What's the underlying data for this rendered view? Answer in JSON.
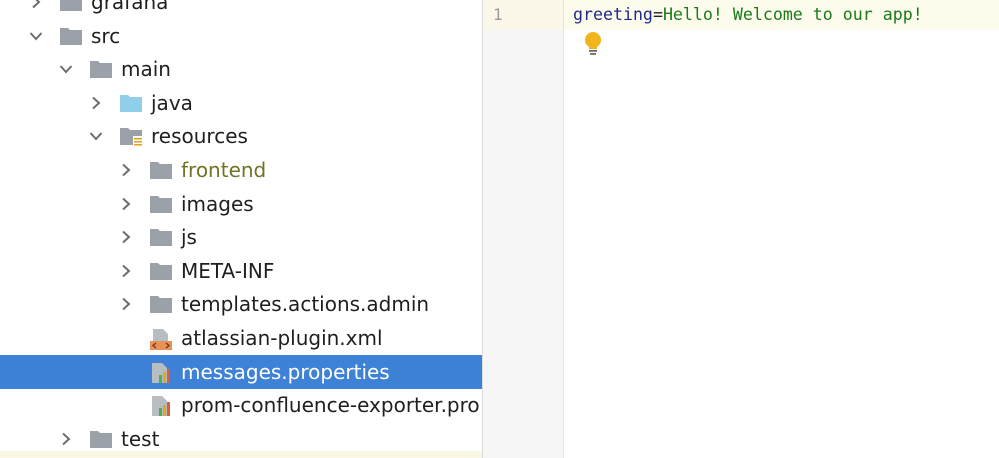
{
  "project_tree": {
    "items": [
      {
        "label": "grafana",
        "depth": 1,
        "expanded": false,
        "icon": "folder-icon",
        "has_chevron": true
      },
      {
        "label": "src",
        "depth": 1,
        "expanded": true,
        "icon": "folder-icon",
        "has_chevron": true
      },
      {
        "label": "main",
        "depth": 2,
        "expanded": true,
        "icon": "folder-icon",
        "has_chevron": true
      },
      {
        "label": "java",
        "depth": 3,
        "expanded": false,
        "icon": "source-folder-icon",
        "has_chevron": true
      },
      {
        "label": "resources",
        "depth": 3,
        "expanded": true,
        "icon": "resources-folder-icon",
        "has_chevron": true
      },
      {
        "label": "frontend",
        "depth": 4,
        "expanded": false,
        "icon": "folder-icon",
        "has_chevron": true,
        "highlight": "olive"
      },
      {
        "label": "images",
        "depth": 4,
        "expanded": false,
        "icon": "folder-icon",
        "has_chevron": true
      },
      {
        "label": "js",
        "depth": 4,
        "expanded": false,
        "icon": "folder-icon",
        "has_chevron": true
      },
      {
        "label": "META-INF",
        "depth": 4,
        "expanded": false,
        "icon": "folder-icon",
        "has_chevron": true
      },
      {
        "label": "templates.actions.admin",
        "depth": 4,
        "expanded": false,
        "icon": "folder-icon",
        "has_chevron": true
      },
      {
        "label": "atlassian-plugin.xml",
        "depth": 4,
        "icon": "xml-file-icon",
        "has_chevron": false
      },
      {
        "label": "messages.properties",
        "depth": 4,
        "icon": "properties-file-icon",
        "has_chevron": false,
        "selected": true
      },
      {
        "label": "prom-confluence-exporter.pro",
        "depth": 4,
        "icon": "properties-file-icon",
        "has_chevron": false
      },
      {
        "label": "test",
        "depth": 2,
        "expanded": false,
        "icon": "folder-icon",
        "has_chevron": true
      }
    ]
  },
  "editor": {
    "line_number": "1",
    "key": "greeting",
    "separator": "=",
    "value": "Hello! Welcome to our app!",
    "intention_icon": "lightbulb-icon"
  },
  "colors": {
    "selection": "#3d82d6",
    "folder": "#9aa1a8",
    "source_folder": "#8fcfea",
    "olive_label": "#727425",
    "key": "#1f2a8a",
    "value": "#1a7a1a",
    "bulb": "#f2b41b"
  }
}
